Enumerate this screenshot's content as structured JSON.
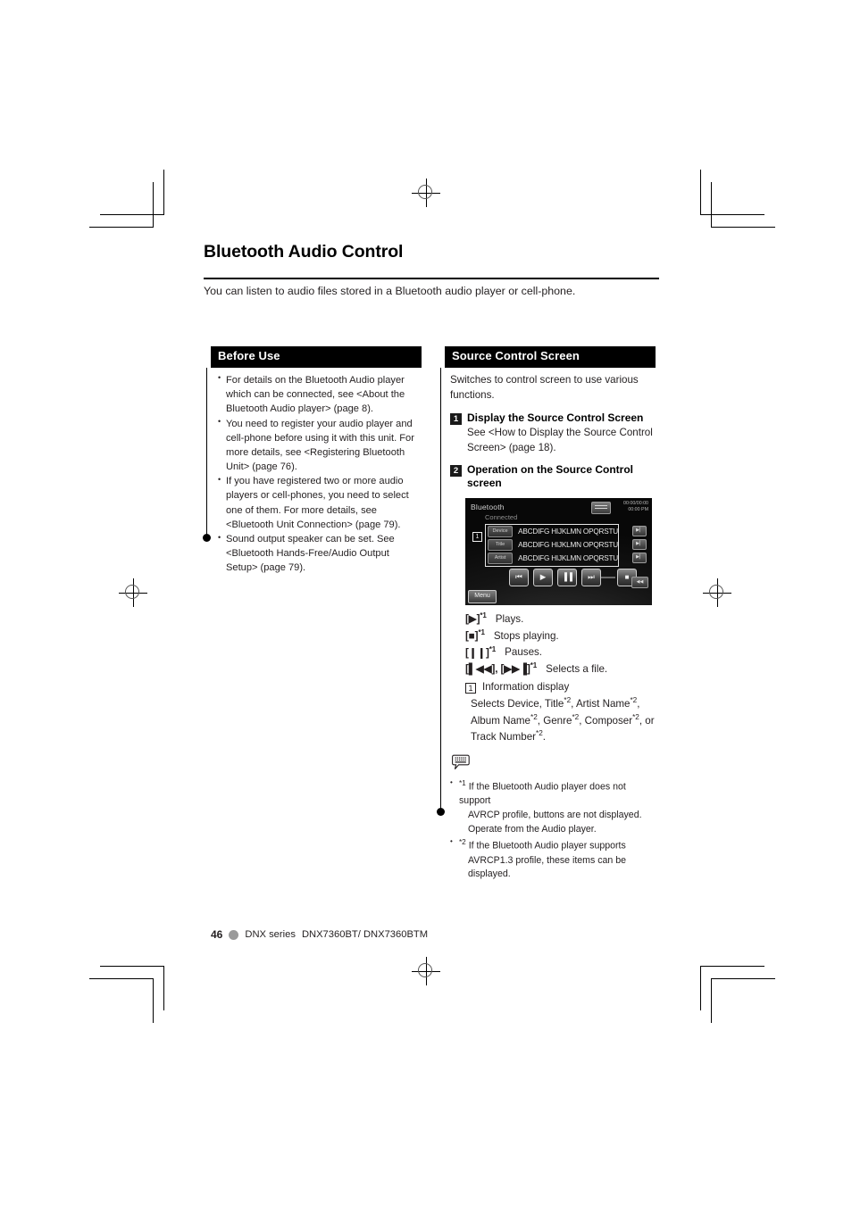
{
  "document": {
    "chapter_title": "Bluetooth Audio Control",
    "intro": "You can listen to audio files stored in a Bluetooth audio player or cell-phone."
  },
  "before_use": {
    "heading": "Before Use",
    "bullets": [
      "For details on the Bluetooth Audio player which can be connected, see <About the Bluetooth Audio player> (page 8).",
      "You need to register your audio player and cell-phone before using it with this unit. For more details, see <Registering Bluetooth Unit> (page 76).",
      "If you have registered two or more audio players or cell-phones, you need to select one of them. For more details, see <Bluetooth Unit Connection> (page 79).",
      "Sound output speaker can be set. See <Bluetooth Hands-Free/Audio Output Setup> (page 79)."
    ]
  },
  "source_control": {
    "heading": "Source Control Screen",
    "intro": "Switches  to control screen to use various functions.",
    "steps": [
      {
        "number": "1",
        "title": "Display the Source Control Screen",
        "body": "See <How to Display the Source Control Screen> (page 18)."
      },
      {
        "number": "2",
        "title": "Operation on the Source Control screen"
      }
    ]
  },
  "device_screen": {
    "title": "Bluetooth",
    "status": "Connected",
    "clock_line1": "00:00/00:00",
    "clock_line2": "00:00 PM",
    "callout_number": "1",
    "rows": [
      {
        "label": "Device",
        "value": "ABCDIFG HIJKLMN OPQRSTU",
        "side": "▶▏"
      },
      {
        "label": "Title",
        "value": "ABCDIFG HIJKLMN OPQRSTU",
        "side": "▶▏"
      },
      {
        "label": "Artist",
        "value": "ABCDIFG HIJKLMN OPQRSTU",
        "side": "▶▏"
      }
    ],
    "transport": [
      "⏮",
      "▶",
      "▐▐",
      "⏭"
    ],
    "stop_key": "■",
    "menu_label": "Menu",
    "corner_label": "◀◀"
  },
  "key_legend": [
    {
      "key": "[▶]",
      "note": "*1",
      "desc": "Plays."
    },
    {
      "key": "[■]",
      "note": "*1",
      "desc": "Stops playing."
    },
    {
      "key": "[❙❙]",
      "note": "*1",
      "desc": "Pauses."
    },
    {
      "key": "[▌◀◀], [▶▶▐]",
      "note": "*1",
      "desc": "Selects a file."
    }
  ],
  "information_display": {
    "badge": "1",
    "title": "Information display",
    "line1_parts": [
      "Selects Device, Title",
      "*2",
      ", Artist Name",
      "*2",
      ","
    ],
    "line2_parts": [
      "Album Name",
      "*2",
      ", Genre",
      "*2",
      ", Composer",
      "*2",
      ", or"
    ],
    "line3_parts": [
      "Track Number",
      "*2",
      "."
    ]
  },
  "notes": {
    "icon": "note-bubble-icon",
    "items": [
      {
        "marker": "*1",
        "lines": [
          "If the Bluetooth Audio player does not support",
          "AVRCP profile, buttons are not displayed.",
          "Operate from the Audio player."
        ]
      },
      {
        "marker": "*2",
        "lines": [
          "If the Bluetooth Audio player supports",
          "AVRCP1.3 profile, these items can be displayed."
        ]
      }
    ]
  },
  "footer": {
    "page_number": "46",
    "series": "DNX series",
    "models": "DNX7360BT/ DNX7360BTM"
  }
}
